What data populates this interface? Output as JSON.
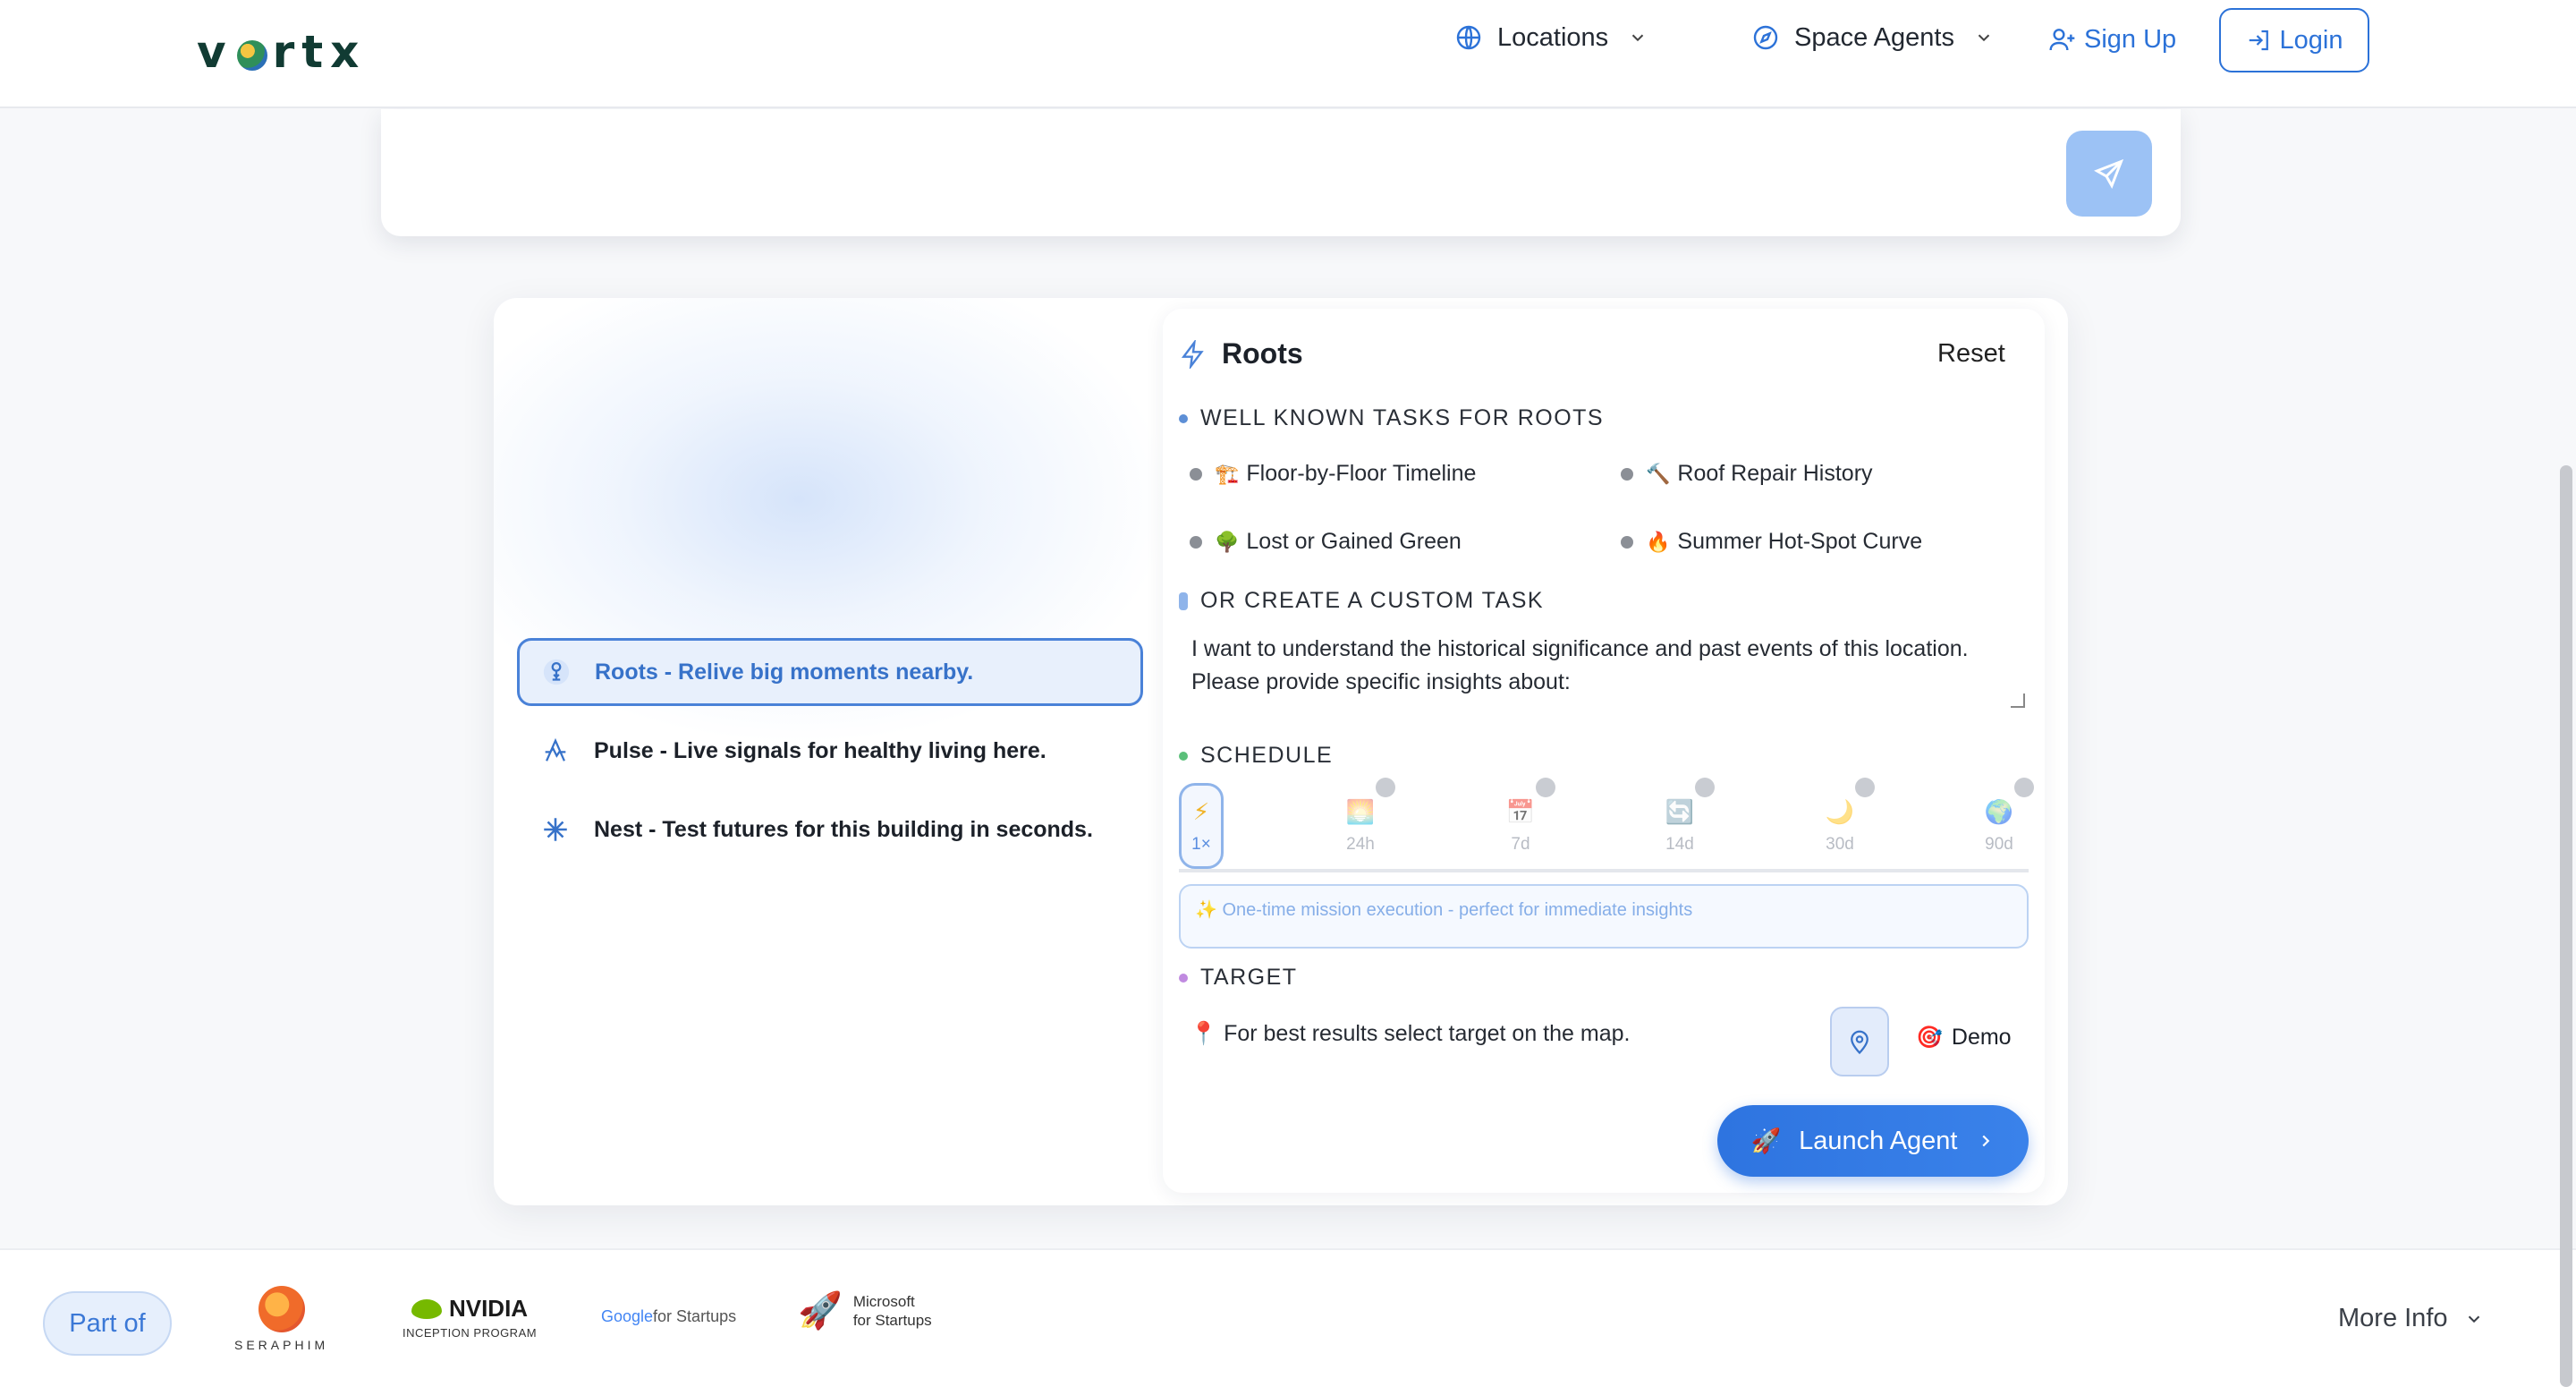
{
  "nav": {
    "logo": "vortx",
    "locations": "Locations",
    "space_agents": "Space Agents",
    "sign_up": "Sign Up",
    "login": "Login"
  },
  "search": {
    "value": "",
    "placeholder": ""
  },
  "modes": [
    {
      "label": "Roots - Relive big moments nearby.",
      "active": true
    },
    {
      "label": "Pulse - Live signals for healthy living here.",
      "active": false
    },
    {
      "label": "Nest - Test futures for this building in seconds.",
      "active": false
    }
  ],
  "panel": {
    "title": "Roots",
    "reset": "Reset",
    "tasks_label": "WELL KNOWN TASKS FOR ROOTS",
    "tasks": [
      {
        "emoji": "🏗️",
        "label": "Floor-by-Floor Timeline"
      },
      {
        "emoji": "🔨",
        "label": "Roof Repair History"
      },
      {
        "emoji": "🌳",
        "label": "Lost or Gained Green"
      },
      {
        "emoji": "🔥",
        "label": "Summer Hot-Spot Curve"
      }
    ],
    "custom_label": "OR CREATE A CUSTOM TASK",
    "custom_text": "I want to understand the historical significance and past events of this location. Please provide specific insights about:",
    "schedule_label": "SCHEDULE",
    "schedule": [
      {
        "icon": "⚡",
        "label": "1×"
      },
      {
        "icon": "🌅",
        "label": "24h"
      },
      {
        "icon": "📅",
        "label": "7d"
      },
      {
        "icon": "🔄",
        "label": "14d"
      },
      {
        "icon": "🌙",
        "label": "30d"
      },
      {
        "icon": "🌍",
        "label": "90d"
      }
    ],
    "schedule_hint": "✨ One-time mission execution - perfect for immediate insights",
    "target_label": "TARGET",
    "target_text": "📍 For best results select target on the map.",
    "demo": "Demo",
    "demo_emoji": "🎯",
    "launch": "Launch Agent",
    "launch_emoji": "🚀"
  },
  "footer": {
    "part_of": "Part of",
    "seraphim": "SERAPHIM",
    "nvidia": "NVIDIA",
    "nvidia_sub": "INCEPTION PROGRAM",
    "google": "Google",
    "google_suffix": " for Startups",
    "microsoft_line1": "Microsoft",
    "microsoft_line2": "for Startups",
    "more_info": "More Info"
  },
  "colors": {
    "accent": "#2c72d8",
    "active_bg": "#e8f0fc",
    "dot_tasks": "#5d8fd6",
    "dot_custom": "#8fb4ea",
    "dot_schedule": "#5bc07a",
    "dot_target": "#c08ae0"
  }
}
